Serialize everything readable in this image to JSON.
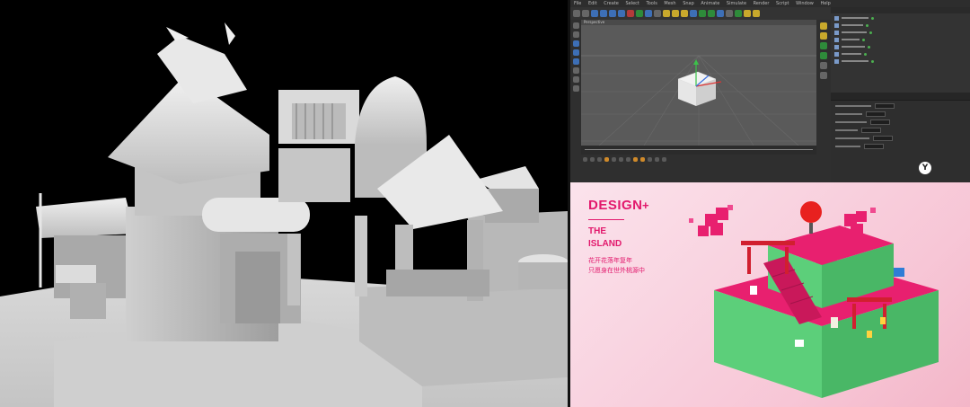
{
  "app": {
    "menu_items": [
      "File",
      "Edit",
      "Create",
      "Select",
      "Tools",
      "Mesh",
      "Snap",
      "Animate",
      "Simulate",
      "Render",
      "Script",
      "Window",
      "Help"
    ],
    "viewport_label": "Perspective",
    "logo_letter": "Y"
  },
  "poster": {
    "title": "DESIGN",
    "plus": "+",
    "subtitle_line1": "THE",
    "subtitle_line2": "ISLAND",
    "tagline_line1": "花开花落年复年",
    "tagline_line2": "只愿身在世外桃源中",
    "accent_color": "#e2186c",
    "scene_colors": {
      "pink": "#e8206f",
      "green": "#5ccf7a",
      "red": "#d11f2f"
    }
  },
  "render": {
    "background": "#000000",
    "model_color": "#d6d6d6"
  }
}
